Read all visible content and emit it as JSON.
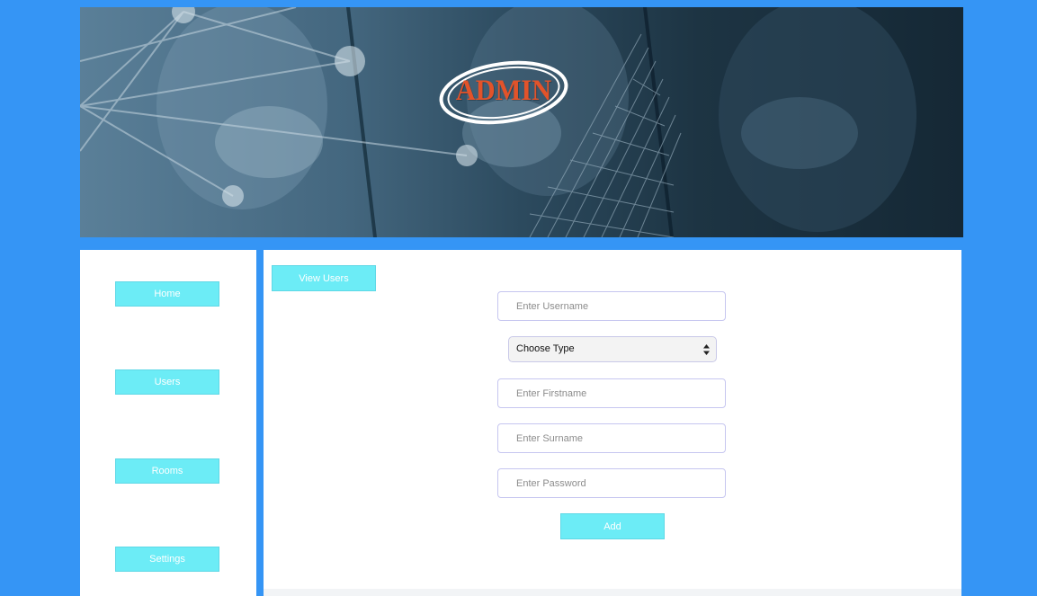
{
  "banner": {
    "logo_text": "ADMIN",
    "logo_text_color": "#e2532a"
  },
  "sidebar": {
    "items": [
      {
        "label": "Home"
      },
      {
        "label": "Users"
      },
      {
        "label": "Rooms"
      },
      {
        "label": "Settings"
      }
    ]
  },
  "main": {
    "view_users_label": "View Users",
    "form": {
      "username_placeholder": "Enter Username",
      "type_select_value": "Choose Type",
      "firstname_placeholder": "Enter Firstname",
      "surname_placeholder": "Enter Surname",
      "password_placeholder": "Enter Password",
      "add_label": "Add"
    }
  },
  "colors": {
    "page_background": "#3595f5",
    "button_accent": "#6cecf6",
    "panel_background": "#ffffff"
  }
}
